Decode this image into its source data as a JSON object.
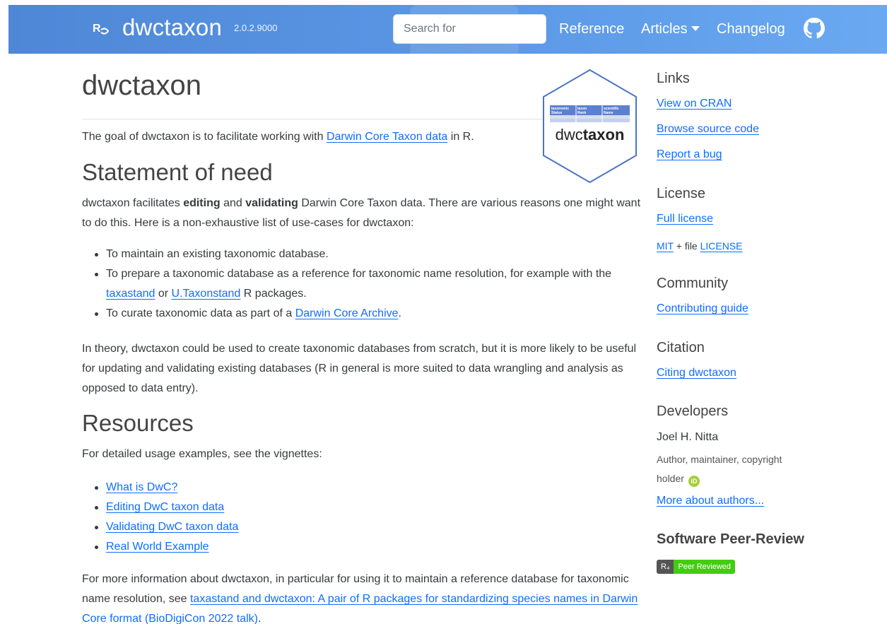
{
  "navbar": {
    "brand": "dwctaxon",
    "version": "2.0.2.9000",
    "search_placeholder": "Search for",
    "links": [
      "Reference",
      "Articles",
      "Changelog"
    ],
    "icons": [
      "rOpenSci-logo-icon",
      "github-icon",
      "caret-down-icon"
    ]
  },
  "main": {
    "title": "dwctaxon",
    "logo": {
      "text_plain": "dwc",
      "text_bold": "taxon",
      "headers": [
        "taxonomic Status",
        "taxon Rank",
        "scientific Name"
      ]
    },
    "intro_before": "The goal of dwctaxon is to facilitate working with ",
    "intro_link": "Darwin Core Taxon data",
    "intro_after": " in R.",
    "need_heading": "Statement of need",
    "need_p_start": "dwctaxon facilitates ",
    "need_bold1": "editing",
    "need_and": " and ",
    "need_bold2": "validating",
    "need_p_end": " Darwin Core Taxon data. There are various reasons one might want to do this. Here is a non-exhaustive list of use-cases for dwctaxon:",
    "uses": {
      "u1": "To maintain an existing taxonomic database.",
      "u2_a": "To prepare a taxonomic database as a reference for taxonomic name resolution, for example with the ",
      "u2_link1": "taxastand",
      "u2_or": " or ",
      "u2_link2": "U.Taxonstand",
      "u2_end": " R packages.",
      "u3_a": "To curate taxonomic data as part of a ",
      "u3_link": "Darwin Core Archive",
      "u3_end": "."
    },
    "theory_p": "In theory, dwctaxon could be used to create taxonomic databases from scratch, but it is more likely to be useful for updating and validating existing databases (R in general is more suited to data wrangling and analysis as opposed to data entry).",
    "resources_heading": "Resources",
    "resources_p": "For detailed usage examples, see the vignettes:",
    "vignettes": [
      "What is DwC?",
      "Editing DwC taxon data",
      "Validating DwC taxon data",
      "Real World Example"
    ],
    "more_p": "For more information about dwctaxon, in particular for using it to maintain a reference database for taxonomic name resolution, see ",
    "more_link": "taxastand and dwctaxon: A pair of R packages for standardizing species names in Darwin Core format (BioDigiCon 2022 talk)",
    "more_end": "."
  },
  "sidebar": {
    "links_heading": "Links",
    "links": [
      "View on CRAN",
      "Browse source code",
      "Report a bug"
    ],
    "license_heading": "License",
    "license_link": "Full license",
    "license_mit": "MIT",
    "license_file": " + file ",
    "license_file_link": "LICENSE",
    "community_heading": "Community",
    "community_link": "Contributing guide",
    "citation_heading": "Citation",
    "citation_link": "Citing dwctaxon",
    "developers_heading": "Developers",
    "developer_name": "Joel H. Nitta",
    "developer_role": "Author, maintainer, copyright holder",
    "orcid_label": "iD",
    "more_authors": "More about authors...",
    "review_heading": "Software Peer-Review",
    "badge_left": "R₄",
    "badge_right": "Peer Reviewed"
  },
  "colors": {
    "navbar": "#5b98e6",
    "link": "#0d6efd",
    "badge_green": "#44cc11",
    "orcid": "#a6ce39"
  }
}
